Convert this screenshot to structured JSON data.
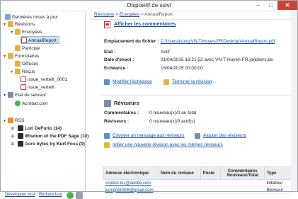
{
  "window": {
    "title": "Dispositif de suivi",
    "close": "✕",
    "maximize": "□",
    "minimize": "–"
  },
  "tree": {
    "recent": "Dernières mises à jour",
    "revisions": "Révisions",
    "sent": "Envoyées",
    "annual_report": "AnnualReport",
    "joined": "Participé",
    "forms": "Formulaires",
    "distributed": "Diffusés",
    "received": "Reçus",
    "issue1": "issue_verteilt_0001",
    "issue2": "issue_verteilt",
    "server_state": "Etat du serveur",
    "acrobat": "Acrobat.com",
    "rss": "RSS",
    "feed1": "Lori DeFurio (14)",
    "feed2": "Wisdom of the PDF Sage (10)",
    "feed3": "Acro bytes by Kurt Foss (0)"
  },
  "footer": {
    "expand_all": "Développer tout",
    "collapse_all": "Réduire tout"
  },
  "breadcrumb": {
    "b1": "Révisions",
    "b2": "Envoyées",
    "b3": "AnnualReport",
    "sep": " > "
  },
  "detail": {
    "show_comments": "Afficher les commentaires",
    "file_location_label": "Emplacement du fichier :",
    "file_location": "C:\\Users\\luong.VN-T-Huyen-FR\\Desktop\\AnnualReport.pdf",
    "state_label": "Etat :",
    "state": "Actif",
    "sent_date_label": "Date d'envoi :",
    "sent_date": "01/04/2015 16:21:53 avec VN-T-Huyen-FR.jonckers.be",
    "due_label": "Echéance :",
    "due": "15/04/2015 00:00:00",
    "modify_due": "Modifier l'échéance",
    "finish_review": "Terminer la révision",
    "reviewers_header": "Réviseurs",
    "comments_label": "Commentaires :",
    "comments_value": "0 nouveau(x)/0 au total",
    "reviewers_label": "Réviseurs :",
    "reviewers_value": "0 nouveau(x)/0 actif(s)",
    "email_reviewers": "Envoyer un message aux réviseurs",
    "add_reviewers": "Ajouter des réviseurs",
    "new_review": "Initier une nouvelle révision avec les mêmes réviseurs"
  },
  "table": {
    "headers": [
      "Adresse électronique",
      "Nom du réviseur",
      "Poste",
      "Commentaires Nouveaux/Total",
      "Type"
    ],
    "rows": [
      [
        "contest-loc@adobe.com",
        "",
        "",
        "",
        "Initiateur"
      ],
      [
        "luongnd0906@gmail.com",
        "",
        "",
        "",
        "Réviseur"
      ]
    ]
  },
  "colors": {
    "link": "#1a4fa3",
    "close_button": "#c9453a",
    "selection": "#cde3f7"
  }
}
